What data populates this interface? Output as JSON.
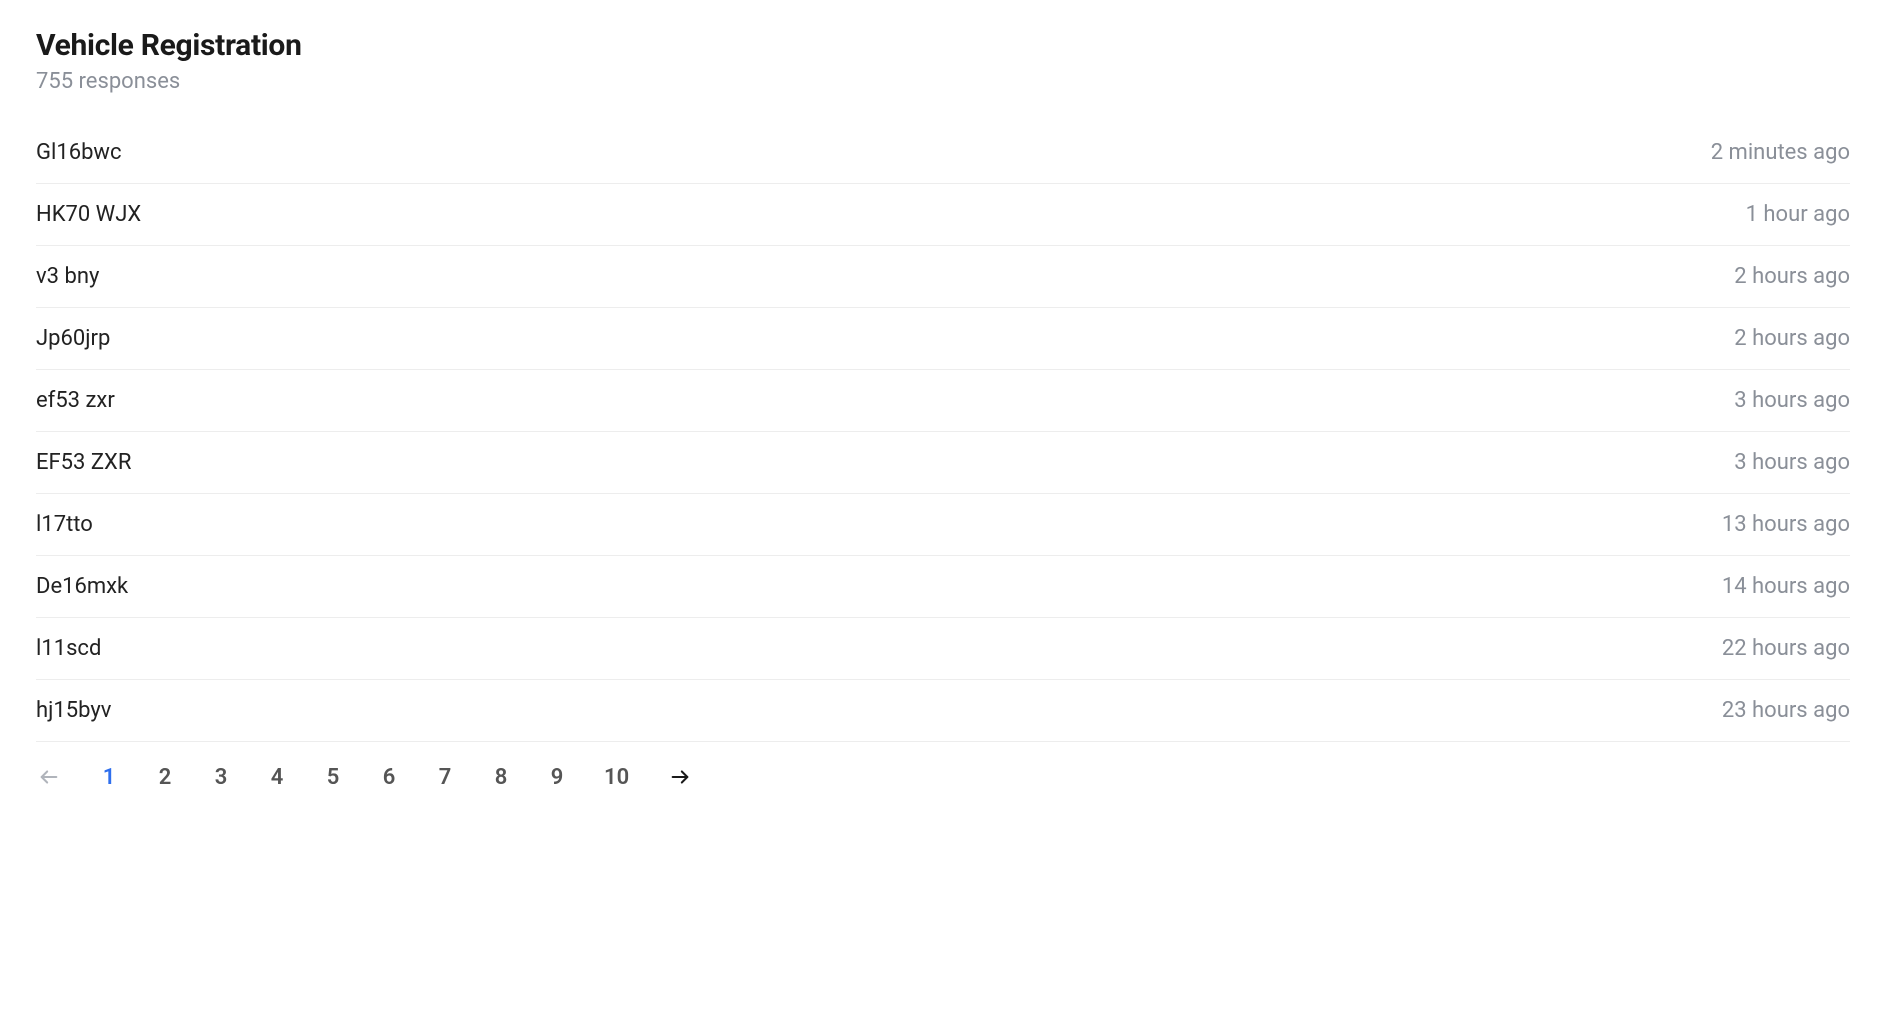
{
  "header": {
    "title": "Vehicle Registration",
    "subtitle": "755 responses"
  },
  "rows": [
    {
      "value": "Gl16bwc",
      "time": "2 minutes ago"
    },
    {
      "value": "HK70 WJX",
      "time": "1 hour ago"
    },
    {
      "value": "v3 bny",
      "time": "2 hours ago"
    },
    {
      "value": "Jp60jrp",
      "time": "2 hours ago"
    },
    {
      "value": "ef53 zxr",
      "time": "3 hours ago"
    },
    {
      "value": "EF53 ZXR",
      "time": "3 hours ago"
    },
    {
      "value": "l17tto",
      "time": "13 hours ago"
    },
    {
      "value": "De16mxk",
      "time": "14 hours ago"
    },
    {
      "value": "l11scd",
      "time": "22 hours ago"
    },
    {
      "value": "hj15byv",
      "time": "23 hours ago"
    }
  ],
  "pagination": {
    "pages": [
      "1",
      "2",
      "3",
      "4",
      "5",
      "6",
      "7",
      "8",
      "9",
      "10"
    ],
    "current": "1"
  }
}
